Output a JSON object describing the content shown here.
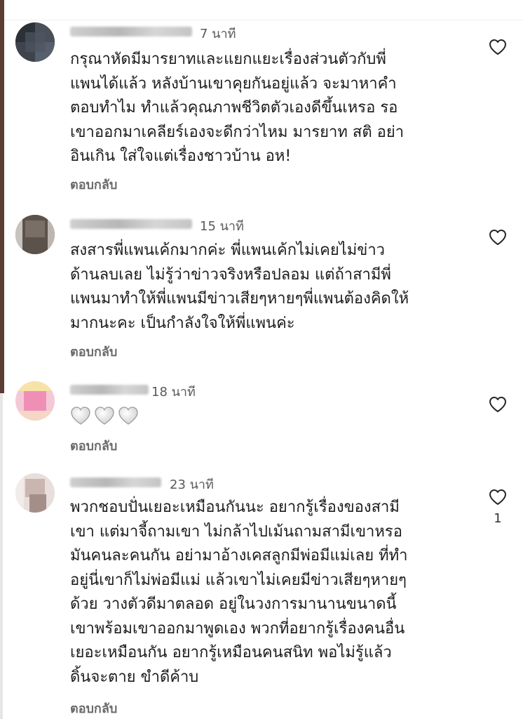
{
  "comments": [
    {
      "time": "7 นาที",
      "text": "กรุณาหัดมีมารยาทและแยกแยะเรื่องส่วนตัวกับพี่\nแพนได้แล้ว หลังบ้านเขาคุยกันอยู่แล้ว จะมาหาคำ\nตอบทำไม ทำแล้วคุณภาพชีวิตตัวเองดีขึ้นเหรอ รอ\nเขาออกมาเคลียร์เองจะดีกว่าไหม มารยาท สติ อย่า\nอินเกิน ใส่ใจแต่เรื่องชาวบ้าน  อห!",
      "reply_label": "ตอบกลับ",
      "like_count": ""
    },
    {
      "time": "15 นาที",
      "text": "สงสารพี่แพนเค้กมากค่ะ พี่แพนเค้กไม่เคยไม่ข่าว\nด้านลบเลย ไม่รู้ว่าข่าวจริงหรือปลอม แต่ถ้าสามีพี่\nแพนมาทำให้พี่แพนมีข่าวเสียๆหายๆพี่แพนต้องคิดให้\nมากนะคะ เป็นกำลังใจให้พี่แพนค่ะ",
      "reply_label": "ตอบกลับ",
      "like_count": ""
    },
    {
      "time": "18 นาที",
      "emoji": [
        "white-heart-icon",
        "white-heart-icon",
        "white-heart-icon"
      ],
      "reply_label": "ตอบกลับ",
      "like_count": ""
    },
    {
      "time": "23 นาที",
      "text": "พวกชอบปั่นเยอะเหมือนกันนะ อยากรู้เรื่องของสามี\nเขา แต่มาจี้ถามเขา ไม่กล้าไปเม้นถามสามีเขาหรอ\nมันคนละคนกัน อย่ามาอ้างเคสลูกมีพ่อมีแม่เลย ที่ทำ\nอยู่นี่เขาก็ไม่พ่อมีแม่ แล้วเขาไม่เคยมีข่าวเสียๆหายๆ\nด้วย วางตัวดีมาตลอด อยู่ในวงการมานานขนาดนี้\nเขาพร้อมเขาออกมาพูดเอง พวกที่อยากรู้เรื่องคนอื่น\nเยอะเหมือนกัน อยากรู้เหมือนคนสนิท พอไม่รู้แล้ว\nดิ้นจะตาย ขำดีค้าบ",
      "reply_label": "ตอบกลับ",
      "like_count": "1"
    }
  ],
  "colors": {
    "text": "#1c1c1c",
    "muted": "#6b6b6b",
    "time": "#5a5a5a",
    "heart_outline": "#262626"
  },
  "icons": {
    "like": "heart-outline-icon"
  }
}
